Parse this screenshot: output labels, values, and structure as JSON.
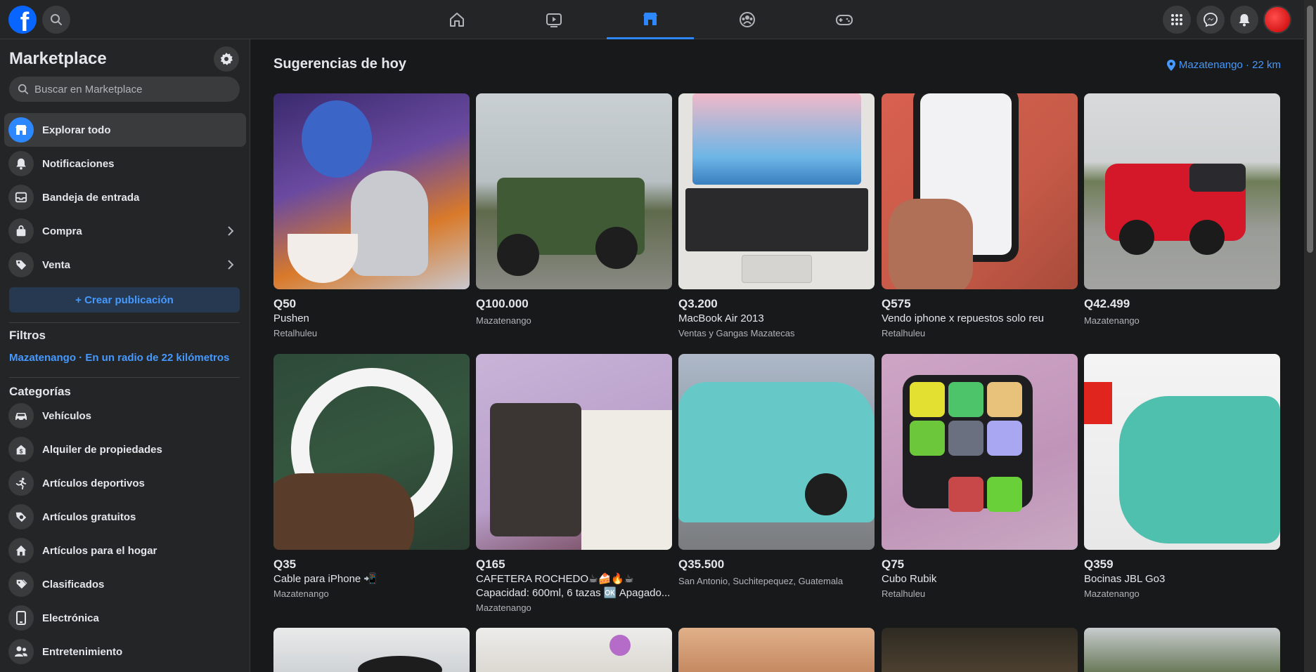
{
  "topbar": {
    "logo": "f",
    "nav": [
      "home-icon",
      "video-icon",
      "marketplace-icon",
      "groups-icon",
      "gaming-icon"
    ],
    "active_nav": "marketplace-icon"
  },
  "sidebar": {
    "title": "Marketplace",
    "search_placeholder": "Buscar en Marketplace",
    "items": [
      {
        "label": "Explorar todo",
        "icon": "shop-icon"
      },
      {
        "label": "Notificaciones",
        "icon": "bell-icon"
      },
      {
        "label": "Bandeja de entrada",
        "icon": "inbox-icon"
      },
      {
        "label": "Compra",
        "icon": "bag-icon"
      },
      {
        "label": "Venta",
        "icon": "tag-icon"
      }
    ],
    "create_label": "+ Crear publicación",
    "filters_heading": "Filtros",
    "filter_value": "Mazatenango · En un radio de 22 kilómetros",
    "categories_heading": "Categorías",
    "categories": [
      {
        "label": "Vehículos",
        "icon": "car-icon"
      },
      {
        "label": "Alquiler de propiedades",
        "icon": "house-dollar-icon"
      },
      {
        "label": "Artículos deportivos",
        "icon": "running-icon"
      },
      {
        "label": "Artículos gratuitos",
        "icon": "free-tag-icon"
      },
      {
        "label": "Artículos para el hogar",
        "icon": "home-goods-icon"
      },
      {
        "label": "Clasificados",
        "icon": "classifieds-icon"
      },
      {
        "label": "Electrónica",
        "icon": "phone-icon"
      },
      {
        "label": "Entretenimiento",
        "icon": "people-icon"
      }
    ]
  },
  "main": {
    "title": "Sugerencias de hoy",
    "location": "Mazatenango · 22 km",
    "listings": [
      {
        "price": "Q50",
        "title": "Pushen",
        "location": "Retalhuleu"
      },
      {
        "price": "Q100.000",
        "title": "",
        "location": "Mazatenango"
      },
      {
        "price": "Q3.200",
        "title": "MacBook Air 2013",
        "location": "Ventas y Gangas Mazatecas"
      },
      {
        "price": "Q575",
        "title": "Vendo iphone x repuestos solo reu",
        "location": "Retalhuleu"
      },
      {
        "price": "Q42.499",
        "title": "",
        "location": "Mazatenango"
      },
      {
        "price": "Q35",
        "title": "Cable para iPhone 📲",
        "location": "Mazatenango"
      },
      {
        "price": "Q165",
        "title": "CAFETERA ROCHEDO☕🍰🔥☕ Capacidad: 600ml, 6 tazas 🆗 Apagado...",
        "location": "Mazatenango"
      },
      {
        "price": "Q35.500",
        "title": "",
        "location": "San Antonio, Suchitepequez, Guatemala"
      },
      {
        "price": "Q75",
        "title": "Cubo Rubik",
        "location": "Retalhuleu"
      },
      {
        "price": "Q359",
        "title": "Bocinas JBL Go3",
        "location": "Mazatenango"
      }
    ]
  }
}
